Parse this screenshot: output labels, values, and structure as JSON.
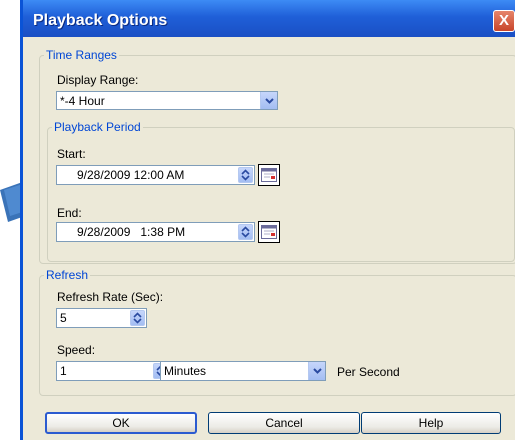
{
  "window": {
    "title": "Playback Options",
    "close_glyph": "X"
  },
  "time_ranges": {
    "legend": "Time Ranges",
    "display_range_label": "Display Range:",
    "display_range_value": "*-4 Hour"
  },
  "playback_period": {
    "legend": "Playback Period",
    "start_label": "Start:",
    "start_value": "9/28/2009 12:00 AM",
    "end_label": "End:",
    "end_value": "9/28/2009   1:38 PM"
  },
  "refresh": {
    "legend": "Refresh",
    "rate_label": "Refresh Rate (Sec):",
    "rate_value": "5",
    "speed_label": "Speed:",
    "speed_value": "1",
    "speed_unit_value": "Minutes",
    "per_second_label": "Per Second"
  },
  "buttons": {
    "ok": "OK",
    "cancel": "Cancel",
    "help": "Help"
  },
  "colors": {
    "title_bar": "#1f5fd8",
    "legend_text": "#0046d5",
    "pointer_arrow": "#3a73b8"
  }
}
